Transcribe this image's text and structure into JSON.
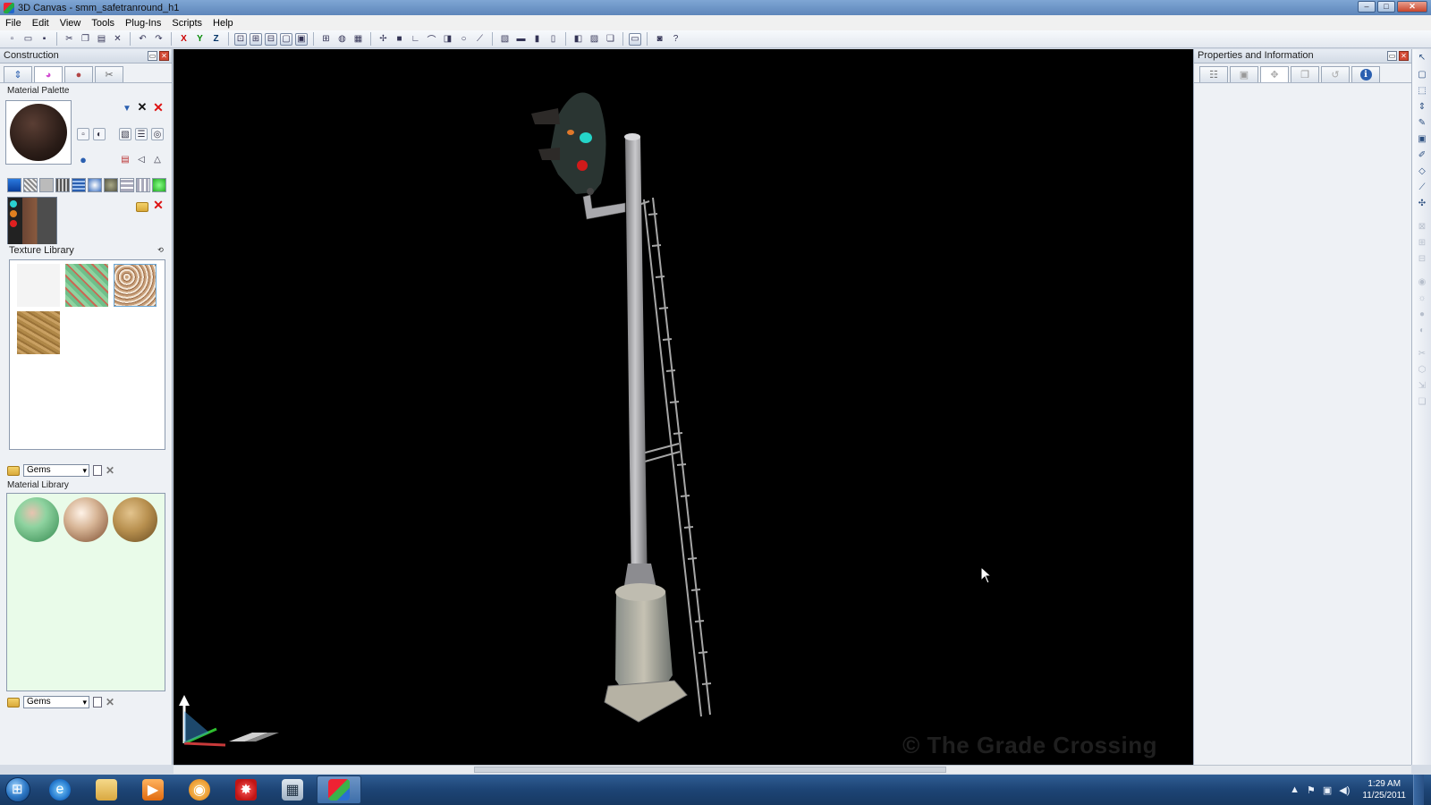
{
  "window": {
    "title": "3D Canvas - smm_safetranround_h1",
    "controls": {
      "minimize": "–",
      "maximize": "□",
      "close": "✕"
    }
  },
  "menu": [
    "File",
    "Edit",
    "View",
    "Tools",
    "Plug-Ins",
    "Scripts",
    "Help"
  ],
  "toolbar": {
    "axis_x": "X",
    "axis_y": "Y",
    "axis_z": "Z"
  },
  "construction_panel": {
    "title": "Construction",
    "tabs": [
      {
        "icon": "arrows-icon",
        "glyph": "⇕"
      },
      {
        "icon": "color-wheel-icon",
        "glyph": "◕"
      },
      {
        "icon": "material-ball-icon",
        "glyph": "●"
      },
      {
        "icon": "tools-icon",
        "glyph": "✂"
      }
    ],
    "material_palette": {
      "label": "Material Palette"
    },
    "texture_library": {
      "label": "Texture Library",
      "textures": [
        "white",
        "green-speckle",
        "gravel",
        "sand"
      ],
      "folder_value": "Gems"
    },
    "material_library": {
      "label": "Material Library",
      "materials": [
        "green-speckle-ball",
        "gravel-ball",
        "sand-ball"
      ],
      "folder_value": "Gems"
    }
  },
  "properties_panel": {
    "title": "Properties and Information",
    "tabs": [
      {
        "icon": "tree-icon",
        "glyph": "☷"
      },
      {
        "icon": "object-icon",
        "glyph": "▣"
      },
      {
        "icon": "transform-icon",
        "glyph": "✥"
      },
      {
        "icon": "copy-icon",
        "glyph": "❐"
      },
      {
        "icon": "history-icon",
        "glyph": "↺"
      },
      {
        "icon": "info-icon",
        "glyph": "ℹ"
      }
    ]
  },
  "viewport": {
    "watermark": "© The Grade Crossing",
    "background": "#000000"
  },
  "taskbar": {
    "items": [
      "internet-explorer",
      "windows-explorer",
      "media-player",
      "blender",
      "paint-splat",
      "calculator",
      "3d-canvas"
    ],
    "clock_time": "1:29 AM",
    "clock_date": "11/25/2011"
  }
}
